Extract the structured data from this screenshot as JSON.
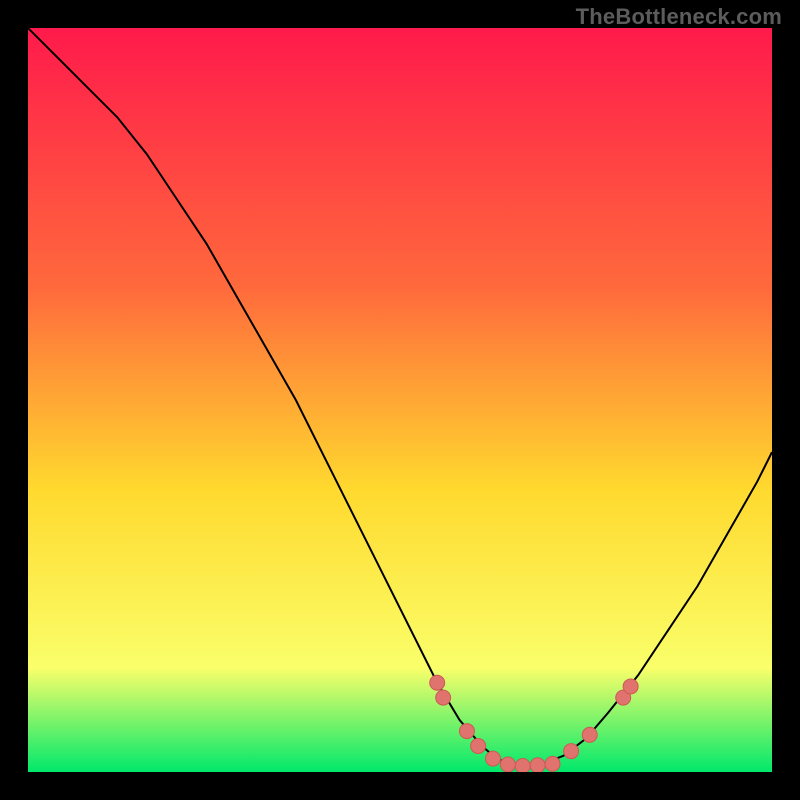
{
  "watermark": "TheBottleneck.com",
  "colors": {
    "gradient_top": "#ff1a4b",
    "gradient_mid1": "#ff6a3c",
    "gradient_mid2": "#ffd92e",
    "gradient_mid3": "#faff6a",
    "gradient_bottom": "#00e86b",
    "curve": "#000000",
    "marker_fill": "#e0736e",
    "marker_stroke": "#cc5a55",
    "border": "#000000"
  },
  "chart_data": {
    "type": "line",
    "title": "",
    "xlabel": "",
    "ylabel": "",
    "xlim": [
      0,
      100
    ],
    "ylim": [
      0,
      100
    ],
    "grid": false,
    "legend": false,
    "series": [
      {
        "name": "bottleneck-curve",
        "x": [
          0,
          4,
          8,
          12,
          16,
          20,
          24,
          28,
          32,
          36,
          40,
          44,
          48,
          52,
          55,
          58,
          61,
          63,
          65,
          67,
          69,
          72,
          75,
          78,
          82,
          86,
          90,
          94,
          98,
          100
        ],
        "y": [
          100,
          96,
          92,
          88,
          83,
          77,
          71,
          64,
          57,
          50,
          42,
          34,
          26,
          18,
          12,
          7,
          3.5,
          1.8,
          1.0,
          0.8,
          1.0,
          2.2,
          4.5,
          8,
          13,
          19,
          25,
          32,
          39,
          43
        ]
      }
    ],
    "markers": [
      {
        "x": 55.0,
        "y": 12.0
      },
      {
        "x": 55.8,
        "y": 10.0
      },
      {
        "x": 59.0,
        "y": 5.5
      },
      {
        "x": 60.5,
        "y": 3.5
      },
      {
        "x": 62.5,
        "y": 1.8
      },
      {
        "x": 64.5,
        "y": 1.0
      },
      {
        "x": 66.5,
        "y": 0.8
      },
      {
        "x": 68.5,
        "y": 0.9
      },
      {
        "x": 70.5,
        "y": 1.1
      },
      {
        "x": 73.0,
        "y": 2.8
      },
      {
        "x": 75.5,
        "y": 5.0
      },
      {
        "x": 80.0,
        "y": 10.0
      },
      {
        "x": 81.0,
        "y": 11.5
      }
    ]
  }
}
